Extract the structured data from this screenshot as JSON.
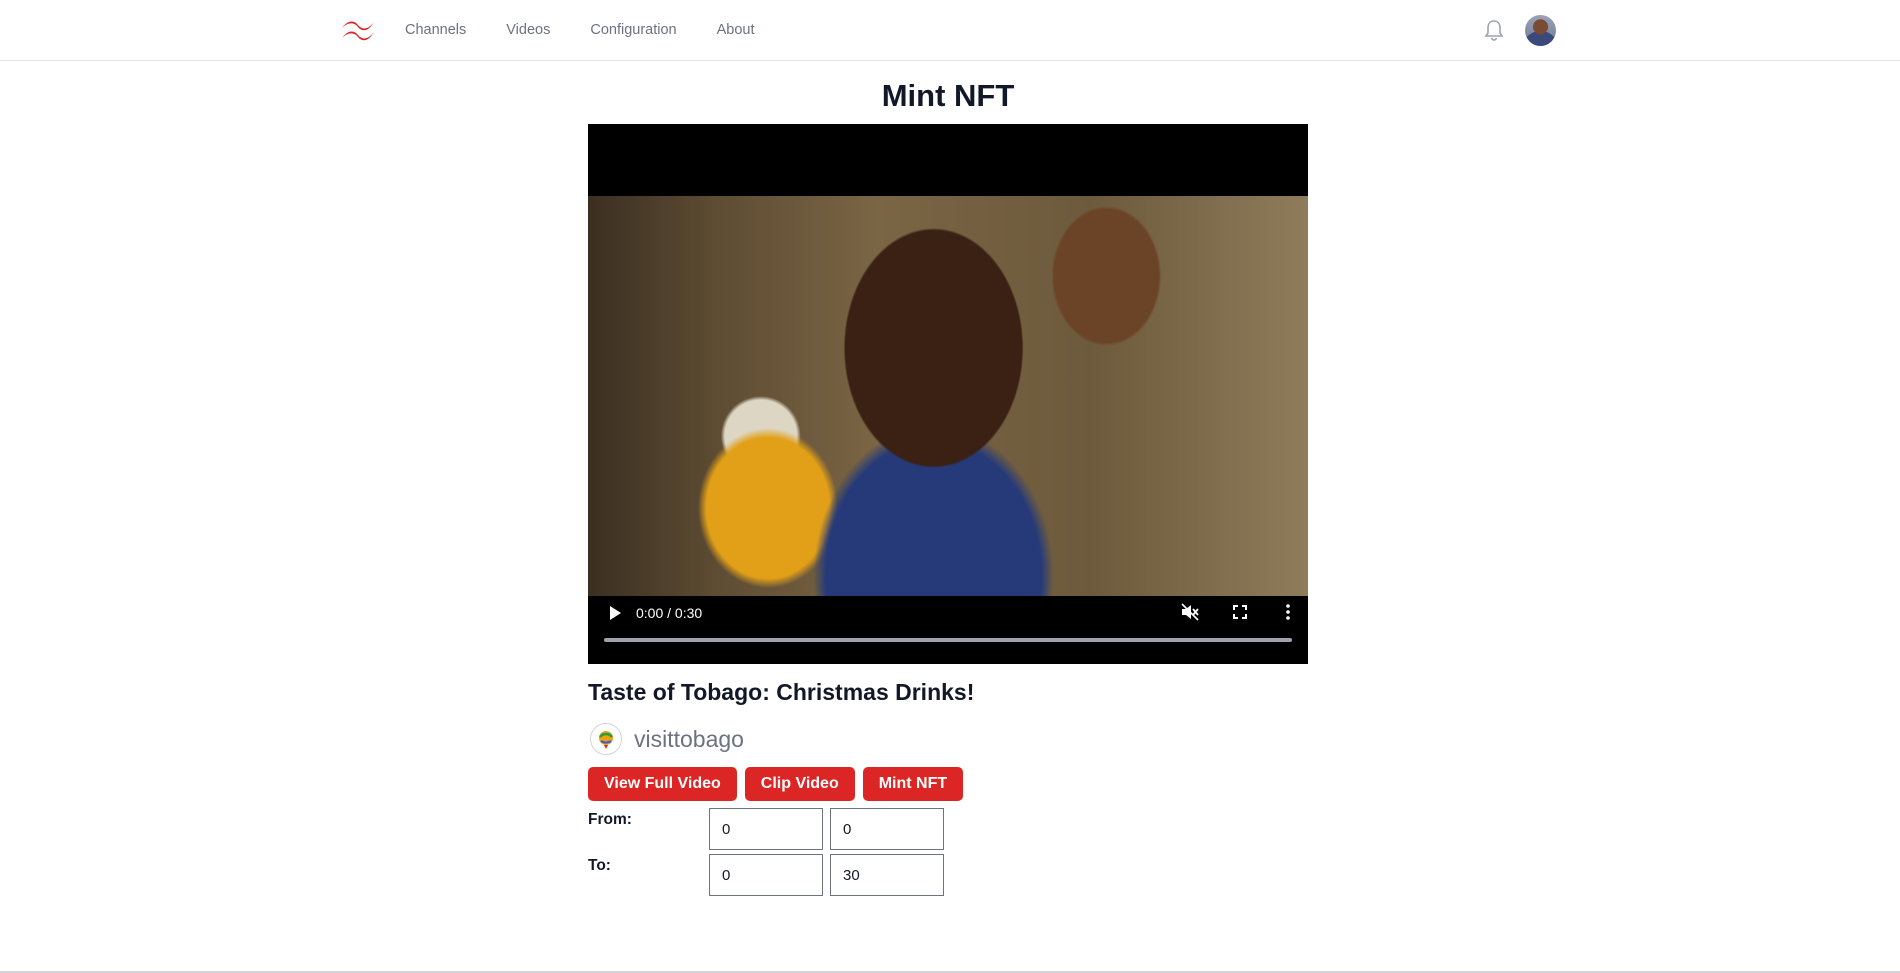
{
  "nav": {
    "logo_icon": "tailwind-wave-logo",
    "links": [
      "Channels",
      "Videos",
      "Configuration",
      "About"
    ],
    "bell_icon": "bell-icon",
    "avatar_icon": "user-avatar"
  },
  "colors": {
    "accent": "#dc2626",
    "text": "#111827",
    "muted": "#6b7280"
  },
  "page": {
    "title": "Mint NFT"
  },
  "player": {
    "time": "0:00 / 0:30",
    "progress": 0,
    "muted": true,
    "icons": [
      "play-icon",
      "mute-icon",
      "fullscreen-icon",
      "more-options-icon"
    ]
  },
  "video": {
    "title": "Taste of Tobago: Christmas Drinks!",
    "channel": "visittobago"
  },
  "actions": {
    "view_full": "View Full Video",
    "clip": "Clip Video",
    "mint": "Mint NFT"
  },
  "range": {
    "from_label": "From:",
    "to_label": "To:",
    "from_min": "0",
    "from_sec": "0",
    "to_min": "0",
    "to_sec": "30"
  }
}
